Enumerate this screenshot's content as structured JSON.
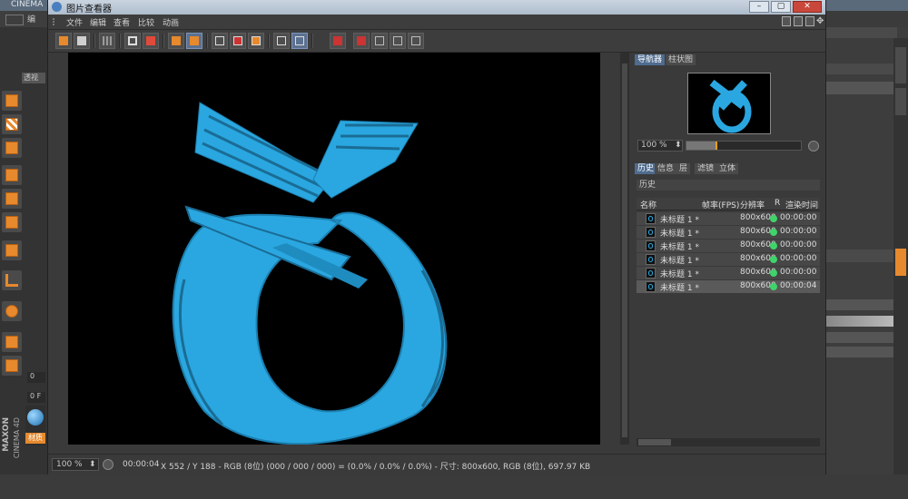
{
  "background_app": {
    "title": "CINEMA",
    "menu_label": "编",
    "left_labels": [
      "透视",
      "0",
      "0 F",
      "材质"
    ],
    "brand": [
      "MAXON",
      "CINEMA 4D"
    ]
  },
  "window": {
    "title": "图片查看器",
    "menu": [
      "文件",
      "编辑",
      "查看",
      "比较",
      "动画"
    ]
  },
  "navigator": {
    "tabs": [
      "导航器",
      "柱状图"
    ],
    "zoom": "100 %",
    "slider_fraction": 0.25
  },
  "history": {
    "tabs": [
      "历史",
      "信息",
      "层",
      "滤镜",
      "立体"
    ],
    "section_label": "历史",
    "columns": [
      "名称",
      "帧率(FPS)",
      "分辨率",
      "R",
      "渲染时间"
    ],
    "rows": [
      {
        "name": "未标题 1 *",
        "resolution": "800x600",
        "time": "00:00:00"
      },
      {
        "name": "未标题 1 *",
        "resolution": "800x600",
        "time": "00:00:00"
      },
      {
        "name": "未标题 1 *",
        "resolution": "800x600",
        "time": "00:00:00"
      },
      {
        "name": "未标题 1 *",
        "resolution": "800x600",
        "time": "00:00:00"
      },
      {
        "name": "未标题 1 *",
        "resolution": "800x600",
        "time": "00:00:00"
      },
      {
        "name": "未标题 1 *",
        "resolution": "800x600",
        "time": "00:00:04"
      }
    ]
  },
  "status": {
    "zoom": "100 %",
    "time": "00:00:04",
    "info": "X 552 / Y 188 - RGB (8位) (000 / 000 / 000) = (0.0% / 0.0% / 0.0%) - 尺寸: 800x600, RGB (8位), 697.97 KB"
  },
  "colors": {
    "accent": "#4f6c8f",
    "render_blue": "#2aa7e0",
    "status_ok": "#3fd46a",
    "slider_knob": "#e6a020"
  }
}
